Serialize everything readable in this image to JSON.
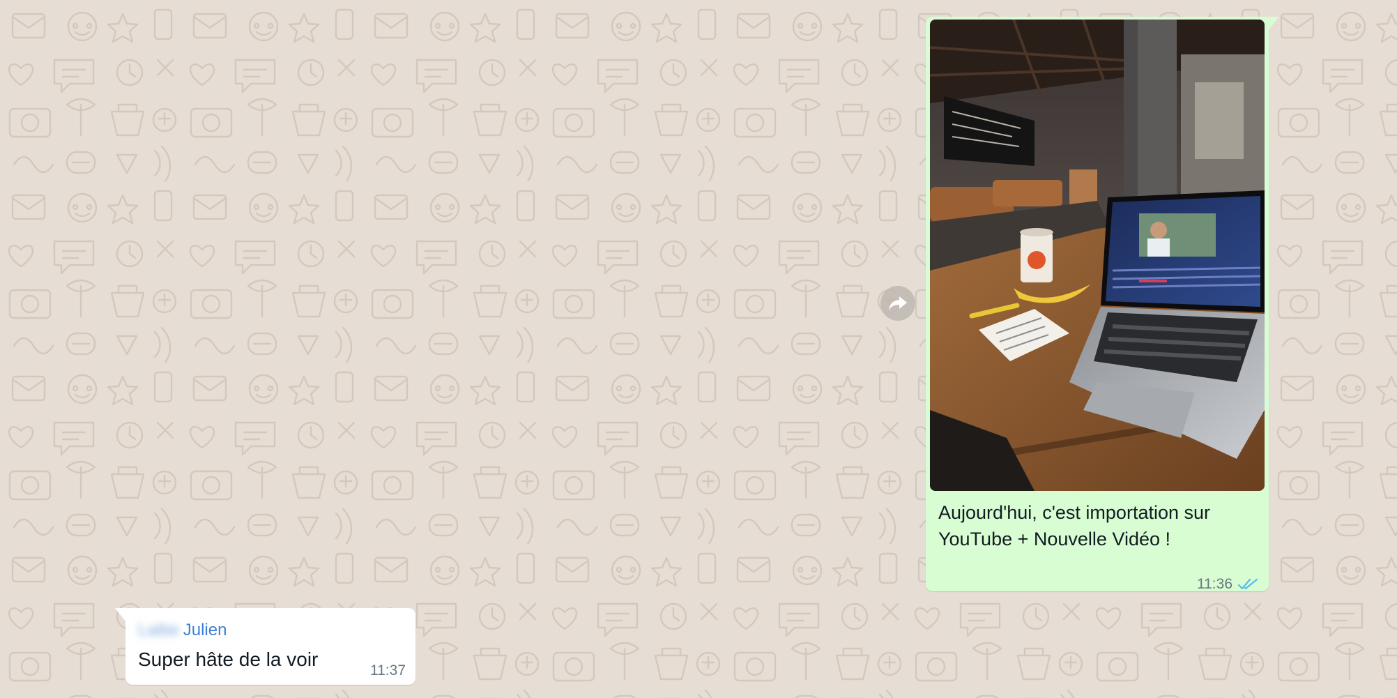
{
  "chat": {
    "outgoing": {
      "caption": "Aujourd'hui, c'est importation sur YouTube + Nouvelle Vidéo !",
      "time": "11:36",
      "status_icon": "double-check-read-icon",
      "bubble_color": "#d9fdd3",
      "read_tick_color": "#53bdeb"
    },
    "incoming": {
      "sender_first": "Laibe",
      "sender_last": "Julien",
      "text": "Super hâte de la voir",
      "time": "11:37",
      "sender_color": "#3d7fd6"
    },
    "forward_icon": "forward-arrow-icon",
    "wallpaper_color": "#e6ddd4"
  }
}
